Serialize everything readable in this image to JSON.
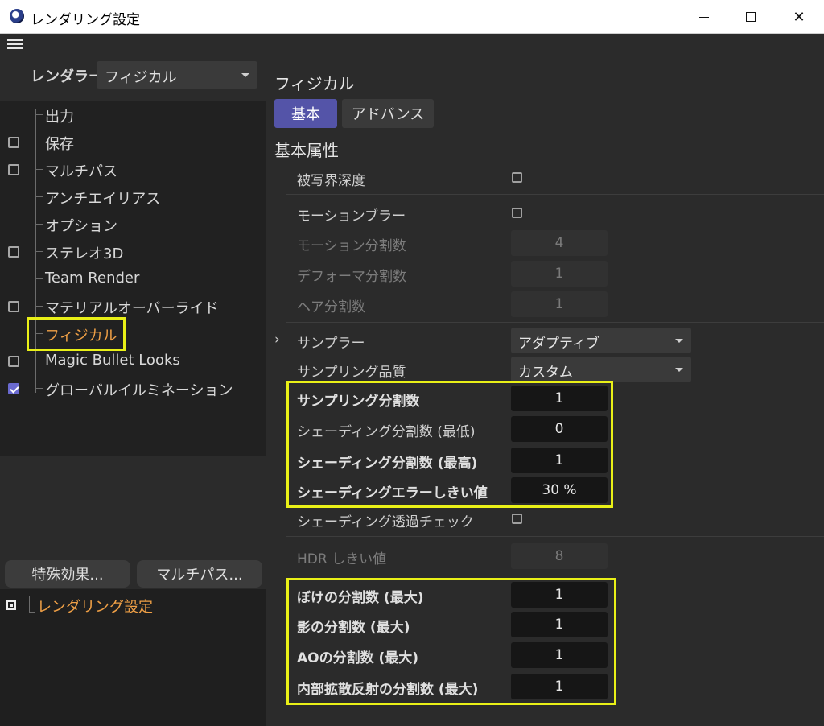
{
  "window": {
    "title": "レンダリング設定"
  },
  "renderer": {
    "label": "レンダラー",
    "value": "フィジカル"
  },
  "tree": {
    "items": [
      {
        "label": "出力",
        "checkbox": false,
        "checked": false,
        "active": false
      },
      {
        "label": "保存",
        "checkbox": true,
        "checked": false,
        "active": false
      },
      {
        "label": "マルチパス",
        "checkbox": true,
        "checked": false,
        "active": false
      },
      {
        "label": "アンチエイリアス",
        "checkbox": false,
        "checked": false,
        "active": false
      },
      {
        "label": "オプション",
        "checkbox": false,
        "checked": false,
        "active": false
      },
      {
        "label": "ステレオ3D",
        "checkbox": true,
        "checked": false,
        "active": false
      },
      {
        "label": "Team Render",
        "checkbox": false,
        "checked": false,
        "active": false
      },
      {
        "label": "マテリアルオーバーライド",
        "checkbox": true,
        "checked": false,
        "active": false
      },
      {
        "label": "フィジカル",
        "checkbox": false,
        "checked": false,
        "active": true
      },
      {
        "label": "Magic Bullet Looks",
        "checkbox": true,
        "checked": false,
        "active": false
      },
      {
        "label": "グローバルイルミネーション",
        "checkbox": true,
        "checked": true,
        "active": false
      }
    ]
  },
  "buttons": {
    "effects": "特殊効果...",
    "multipass": "マルチパス..."
  },
  "settings_tree": {
    "label": "レンダリング設定"
  },
  "panel": {
    "title": "フィジカル",
    "tabs": {
      "basic": "基本",
      "advanced": "アドバンス"
    },
    "group_title": "基本属性",
    "dof": {
      "label": "被写界深度"
    },
    "motion_blur": {
      "label": "モーションブラー"
    },
    "motion_subdiv": {
      "label": "モーション分割数",
      "value": "4"
    },
    "deform_subdiv": {
      "label": "デフォーマ分割数",
      "value": "1"
    },
    "hair_subdiv": {
      "label": "ヘア分割数",
      "value": "1"
    },
    "sampler": {
      "expander": "›",
      "label": "サンプラー",
      "value": "アダプティブ"
    },
    "sampling_quality": {
      "label": "サンプリング品質",
      "value": "カスタム"
    },
    "sampling_subdiv": {
      "label": "サンプリング分割数",
      "value": "1"
    },
    "shading_subdiv_min": {
      "label": "シェーディング分割数 (最低)",
      "value": "0"
    },
    "shading_subdiv_max": {
      "label": "シェーディング分割数 (最高)",
      "value": "1"
    },
    "shading_error": {
      "label": "シェーディングエラーしきい値",
      "value": "30 %"
    },
    "shading_transparency": {
      "label": "シェーディング透過チェック"
    },
    "hdr_threshold": {
      "label": "HDR しきい値",
      "value": "8"
    },
    "blur_subdiv": {
      "label": "ぼけの分割数 (最大)",
      "value": "1"
    },
    "shadow_subdiv": {
      "label": "影の分割数 (最大)",
      "value": "1"
    },
    "ao_subdiv": {
      "label": "AOの分割数 (最大)",
      "value": "1"
    },
    "sss_subdiv": {
      "label": "内部拡散反射の分割数 (最大)",
      "value": "1"
    }
  },
  "colors": {
    "accent": "#5454a8",
    "active_item": "#f0a046",
    "highlight": "#e9f017"
  }
}
